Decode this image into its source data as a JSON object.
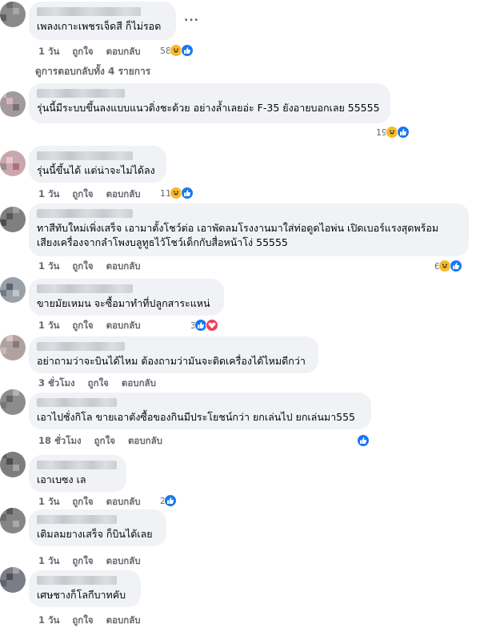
{
  "comments": [
    {
      "text": "เพลงเกาะเพชรเจ็ดสี ก็ไม่รอด",
      "time": "1 วัน",
      "like": "ถูกใจ",
      "reply": "ตอบกลับ",
      "count": "58"
    },
    {
      "text": "รุ่นนี้มีระบบขึ้นลงแบบแนวดิ่งชะด้วย อย่างล้ำเลยอ่ะ F-35 ยังอายบอกเลย 55555",
      "count": "19"
    },
    {
      "text": "รุ่นนี้ขึ้นได้ แต่น่าจะไม่ได้ลง",
      "time": "1 วัน",
      "like": "ถูกใจ",
      "reply": "ตอบกลับ",
      "count": "11"
    },
    {
      "text": "ทาสีทับใหม่เพิ่งเสร็จ เอามาตั้งโชว์ต่อ เอาพัดลมโรงงานมาใส่ท่อดูดไอพ่น เปิดเบอร์แรงสุดพร้อม\nเสียงเครื่องจากลำโพงบลูทูธไว้โชว์เด็กกับสื่อหน้าโง่ 55555",
      "time": "1 วัน",
      "like": "ถูกใจ",
      "reply": "ตอบกลับ",
      "count": "6"
    },
    {
      "text": "ขายมัยเหมน จะซื้อมาทำที่ปลูกสาระแหน่",
      "time": "1 วัน",
      "like": "ถูกใจ",
      "reply": "ตอบกลับ",
      "count": "3"
    },
    {
      "text": "อย่าถามว่าจะบินได้ไหม ต้องถามว่ามันจะติดเครื่องได้ไหมดีกว่า",
      "time": "3 ชั่วโมง",
      "like": "ถูกใจ",
      "reply": "ตอบกลับ"
    },
    {
      "text": "เอาไปชั่งกิโล ขายเอาตังซื้อของกินมีประโยชน์กว่า ยกเล่นไป ยกเล่นมา555",
      "time": "18 ชั่วโมง",
      "like": "ถูกใจ",
      "reply": "ตอบกลับ"
    },
    {
      "text": "เอาเบซง เล",
      "time": "1 วัน",
      "like": "ถูกใจ",
      "reply": "ตอบกลับ",
      "count": "2"
    },
    {
      "text": "เติมลมยางเสร็จ ก็บินได้เลย",
      "time": "1 วัน",
      "like": "ถูกใจ",
      "reply": "ตอบกลับ"
    },
    {
      "text": "เศษชางก็โลกีบาทคับ",
      "time": "1 วัน",
      "like": "ถูกใจ",
      "reply": "ตอบกลับ"
    }
  ],
  "view_replies": "ดูการตอบกลับทั้ง 4 รายการ",
  "more_label": "...",
  "colors": {
    "like": "#1877f2",
    "haha": "#f7b928",
    "love": "#f33e58",
    "bubble": "#f0f2f5",
    "meta": "#65676b"
  },
  "icons": [
    "haha-reaction-icon",
    "like-reaction-icon",
    "love-reaction-icon"
  ]
}
